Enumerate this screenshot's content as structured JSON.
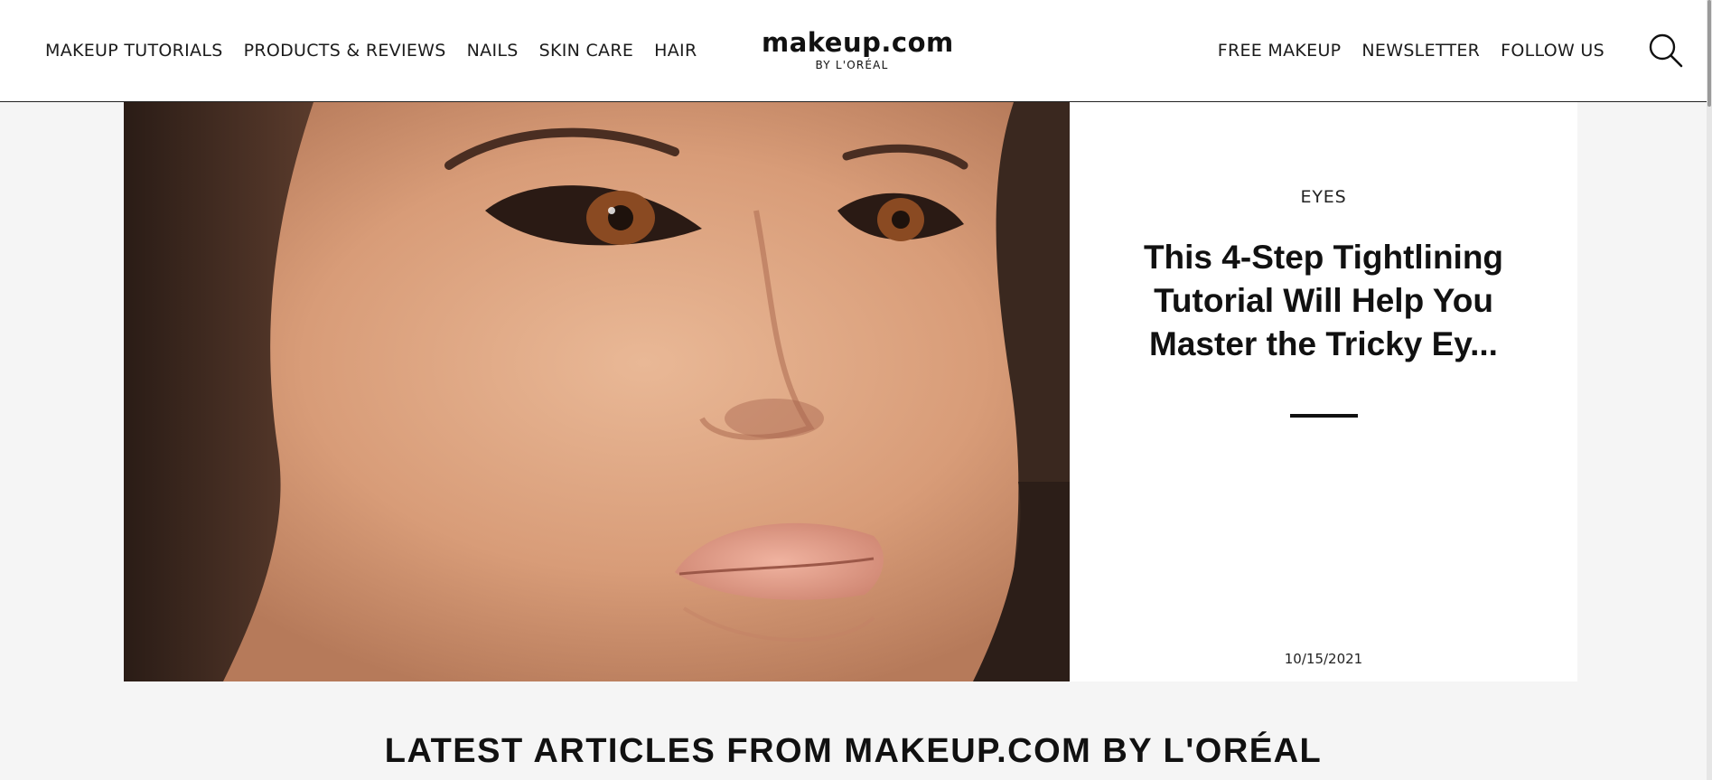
{
  "nav_left": [
    "MAKEUP TUTORIALS",
    "PRODUCTS & REVIEWS",
    "NAILS",
    "SKIN CARE",
    "HAIR"
  ],
  "logo": {
    "main": "makeup.com",
    "sub": "BY L'ORÉAL"
  },
  "nav_right": [
    "FREE MAKEUP",
    "NEWSLETTER",
    "FOLLOW US"
  ],
  "search_icon": "search-icon",
  "hero": {
    "image_icon": "portrait-photo",
    "category": "EYES",
    "headline": "This 4-Step Tightlining Tutorial Will Help You Master the Tricky Ey...",
    "date": "10/15/2021"
  },
  "section_title": "LATEST ARTICLES FROM MAKEUP.COM BY L'ORÉAL",
  "colors": {
    "background": "#f5f5f5",
    "text": "#111111",
    "card": "#ffffff"
  }
}
